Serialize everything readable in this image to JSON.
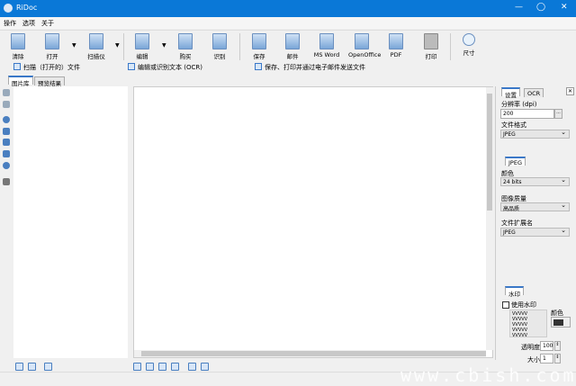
{
  "window": {
    "title": "RiDoc",
    "minimize": "—",
    "maximize": "◯",
    "close": "✕"
  },
  "menu": [
    "操作",
    "选项",
    "关于"
  ],
  "toolbar": {
    "clear": "清除",
    "open": "打开",
    "scanner": "扫描仪",
    "edit": "编辑",
    "buy": "购买",
    "ocr": "识别",
    "save": "保存",
    "mail": "邮件",
    "msword": "MS Word",
    "openoffice": "OpenOffice",
    "pdf": "PDF",
    "print": "打印",
    "size": "尺寸"
  },
  "steps": [
    "扫描（打开的）文件",
    "编辑或识别文本 (OCR)",
    "保存、打印并通过电子邮件发送文件"
  ],
  "left_tabs": [
    "图片库",
    "预览结果"
  ],
  "right_panel": {
    "tabs": [
      "设置",
      "OCR"
    ],
    "close": "✕",
    "resolution_label": "分辨率 (dpi)",
    "resolution_value": "200",
    "browse": "...",
    "format_label": "文件格式",
    "format_value": "JPEG",
    "jpeg_tab": "JPEG",
    "color_label": "颜色",
    "color_value": "24 bits",
    "quality_label": "图像质量",
    "quality_value": "高品质",
    "ext_label": "文件扩展名",
    "ext_value": "JPEG",
    "watermark_tab": "水印",
    "use_watermark": "使用水印",
    "use_watermark_checked": false,
    "watermark_preview": "VVVVV\nVVVVV\nVVVVV\nVVVVV\nVVVVV",
    "color_label2": "颜色",
    "watermark_color": "#333333",
    "opacity_label": "透明度",
    "opacity_value": "100",
    "size_label": "大小",
    "size_value": "1"
  },
  "site_watermark": "www.cbish.com",
  "colors": {
    "titlebar": "#0a78d7",
    "accent": "#3a78c8"
  }
}
